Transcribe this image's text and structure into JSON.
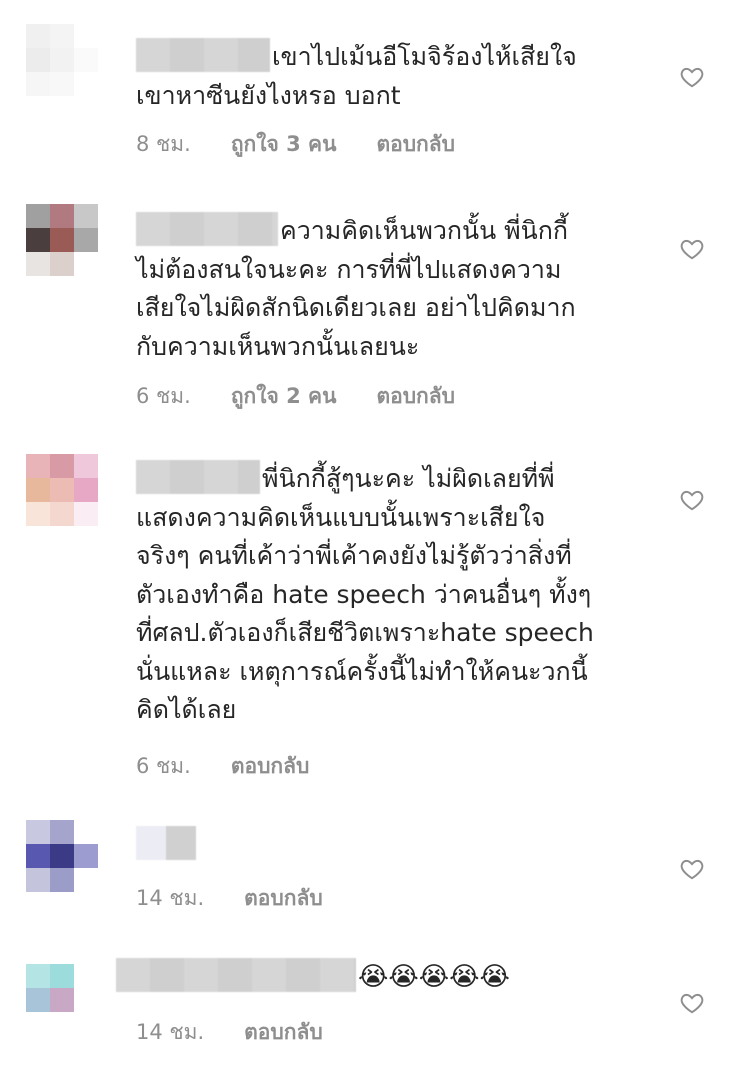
{
  "comments": [
    {
      "text": "เขาไปเม้นอีโมจิร้องไห้เสียใจ\nเขาหาซีนยังไงหรอ บอกt",
      "time": "8 ชม.",
      "likes": "ถูกใจ 3 คน",
      "reply": "ตอบกลับ",
      "avatar_colors": [
        "#f0f0f0",
        "#f4f4f4",
        "#ffffff",
        "#ececec",
        "#f2f2f2",
        "#fafafa",
        "#f6f6f6",
        "#f8f8f8",
        "#ffffff"
      ]
    },
    {
      "text": "ความคิดเห็นพวกนั้น  พี่นิกกี้\nไม่ต้องสนใจนะคะ การที่พี่ไปแสดงความ\nเสียใจไม่ผิดสักนิดเดียวเลย อย่าไปคิดมาก\nกับความเห็นพวกนั้นเลยนะ",
      "time": "6 ชม.",
      "likes": "ถูกใจ 2 คน",
      "reply": "ตอบกลับ",
      "avatar_colors": [
        "#a0a0a0",
        "#b07a80",
        "#c8c8c8",
        "#4a3e3e",
        "#9a5a55",
        "#a8a8a8",
        "#e8e4e2",
        "#dcd0cc",
        "#ffffff"
      ]
    },
    {
      "text": "พี่นิกกี้สู้ๆนะคะ ไม่ผิดเลยที่พี่\nแสดงความคิดเห็นแบบนั้นเพราะเสียใจ\nจริงๆ คนที่เค้าว่าพี่เค้าคงยังไม่รู้ตัวว่าสิ่งที่\nตัวเองทำคือ hate speech ว่าคนอื่นๆ ทั้งๆ\nที่ศลป.ตัวเองก็เสียชีวิตเพราะhate speech\nนั่นแหละ เหตุการณ์ครั้งนี้ไม่ทำให้คนะวกนี้\nคิดได้เลย",
      "time": "6 ชม.",
      "reply": "ตอบกลับ",
      "avatar_colors": [
        "#e8b4b8",
        "#d89aa4",
        "#f0c8dc",
        "#e8b89c",
        "#ecbcb4",
        "#e6a8c4",
        "#f8e4d8",
        "#f4d8d0",
        "#faeef4"
      ]
    },
    {
      "text": "",
      "time": "14 ชม.",
      "reply": "ตอบกลับ",
      "avatar_colors": [
        "#c8c8e0",
        "#a4a4cc",
        "#ffffff",
        "#5858b0",
        "#3a3a86",
        "#9c9cd0",
        "#c4c4dc",
        "#9c9cc8",
        "#ffffff"
      ]
    },
    {
      "text": "😭😭😭😭😭",
      "time": "14 ชม.",
      "reply": "ตอบกลับ",
      "avatar_colors": [
        "#b4e4e4",
        "#9cdcdc",
        "#ffffff",
        "#a8c4d8",
        "#c8a8c4",
        "#ffffff",
        "#ffffff",
        "#ffffff",
        "#ffffff"
      ]
    }
  ]
}
